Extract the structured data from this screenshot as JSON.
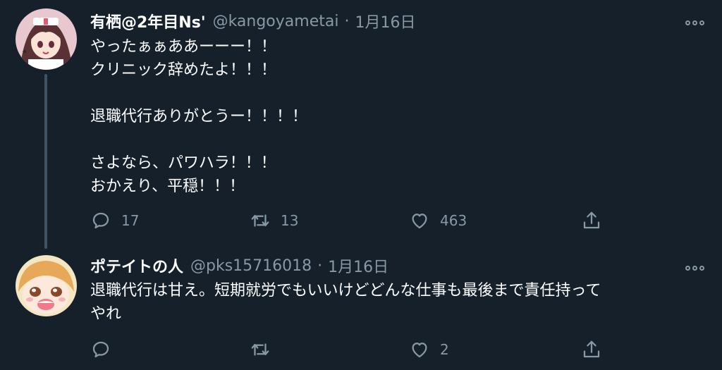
{
  "colors": {
    "background": "#15202b",
    "text": "#ffffff",
    "muted": "#8899a6",
    "thread_line": "#3d5466"
  },
  "tweets": [
    {
      "display_name": "有栖@2年目Ns'",
      "handle": "@kangoyametai",
      "separator": "·",
      "time": "1月16日",
      "lines": [
        "やったぁぁああーーー！！",
        "クリニック辞めたよ！！！",
        "",
        "退職代行ありがとうー！！！！",
        "",
        "さよなら、パワハラ！！！",
        "おかえり、平穏！！！"
      ],
      "replies": "17",
      "retweets": "13",
      "likes": "463"
    },
    {
      "display_name": "ポテイトの人",
      "handle": "@pks15716018",
      "separator": "·",
      "time": "1月16日",
      "lines": [
        "退職代行は甘え。短期就労でもいいけどどんな仕事も最後まで責任持って",
        "やれ"
      ],
      "replies": "",
      "retweets": "",
      "likes": "2"
    }
  ],
  "icons": [
    "reply-icon",
    "retweet-icon",
    "like-icon",
    "share-icon",
    "more-options-icon"
  ]
}
